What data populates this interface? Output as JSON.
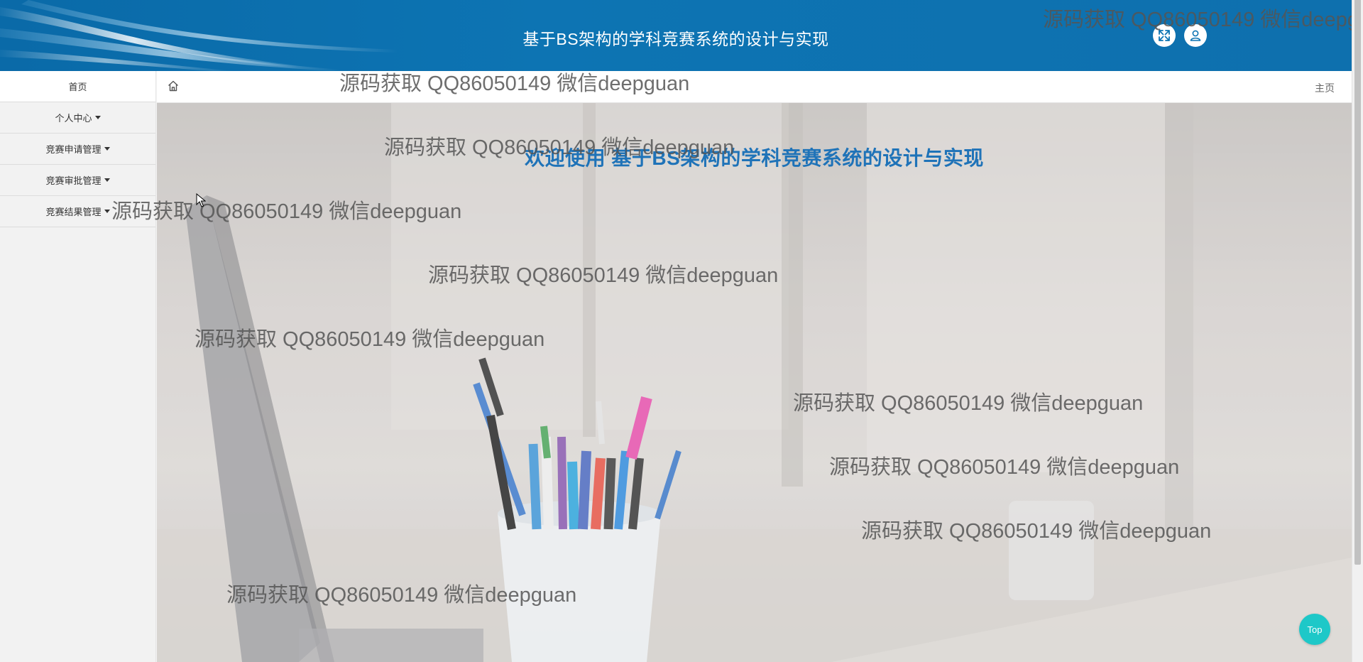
{
  "header": {
    "title": "基于BS架构的学科竞赛系统的设计与实现",
    "fullscreen_icon": "fullscreen-icon",
    "user_icon": "user-icon"
  },
  "sidebar": {
    "items": [
      {
        "label": "首页",
        "has_caret": false
      },
      {
        "label": "个人中心",
        "has_caret": true
      },
      {
        "label": "竞赛申请管理",
        "has_caret": true
      },
      {
        "label": "竞赛审批管理",
        "has_caret": true
      },
      {
        "label": "竞赛结果管理",
        "has_caret": true
      }
    ]
  },
  "breadcrumb": {
    "home_icon": "home-icon",
    "right_label": "主页"
  },
  "main": {
    "welcome": "欢迎使用 基于BS架构的学科竞赛系统的设计与实现"
  },
  "top_button": {
    "label": "Top"
  },
  "watermark": {
    "text": "源码获取 QQ86050149 微信deepguan"
  },
  "colors": {
    "header_bg": "#0d74b3",
    "welcome_text": "#1f73b8",
    "top_button": "#1ec8c8"
  }
}
